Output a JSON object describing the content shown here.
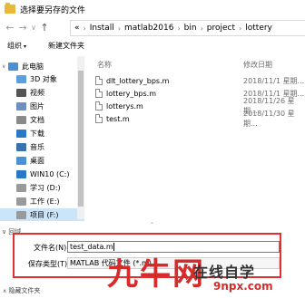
{
  "window": {
    "title": "选择要另存的文件"
  },
  "nav": {
    "back": "←",
    "forward": "→",
    "dropdown": "∨",
    "up": "↑",
    "breadcrumb_sep": "›",
    "path_overflow": "«",
    "breadcrumbs": [
      "Install",
      "matlab2016",
      "bin",
      "project",
      "lottery"
    ]
  },
  "toolbar": {
    "organize": "组织",
    "new_folder": "新建文件夹",
    "caret": "▾"
  },
  "sidebar": {
    "items": [
      {
        "label": "此电脑",
        "icon": "computer-icon",
        "color": "#4a90d9"
      },
      {
        "label": "3D 对象",
        "icon": "cube-icon",
        "color": "#5aa0e0"
      },
      {
        "label": "视频",
        "icon": "video-icon",
        "color": "#555555"
      },
      {
        "label": "图片",
        "icon": "picture-icon",
        "color": "#6a8fc0"
      },
      {
        "label": "文档",
        "icon": "document-icon",
        "color": "#8a8a8a"
      },
      {
        "label": "下载",
        "icon": "download-icon",
        "color": "#2a78c8"
      },
      {
        "label": "音乐",
        "icon": "music-icon",
        "color": "#3a6fb0"
      },
      {
        "label": "桌面",
        "icon": "desktop-icon",
        "color": "#4a90d9"
      },
      {
        "label": "WIN10 (C:)",
        "icon": "drive-icon",
        "color": "#2a78c8"
      },
      {
        "label": "学习 (D:)",
        "icon": "drive-icon",
        "color": "#9a9a9a"
      },
      {
        "label": "工作 (E:)",
        "icon": "drive-icon",
        "color": "#9a9a9a"
      },
      {
        "label": "项目 (F:)",
        "icon": "drive-icon",
        "color": "#9a9a9a"
      }
    ]
  },
  "file_list": {
    "col_name": "名称",
    "col_date": "修改日期",
    "files": [
      {
        "name": "dlt_lottery_bps.m",
        "date": "2018/11/1 星期..."
      },
      {
        "name": "lottery_bps.m",
        "date": "2018/11/1 星期..."
      },
      {
        "name": "lotterys.m",
        "date": "2018/11/26 星期..."
      },
      {
        "name": "test.m",
        "date": "2018/11/30 星期..."
      }
    ]
  },
  "save_form": {
    "filename_label": "文件名(N):",
    "filename_value": "test_data.m",
    "filetype_label": "保存类型(T):",
    "filetype_value": "MATLAB 代码文件 (*.m)",
    "hide_folders": "隐藏文件夹",
    "hide_caret": "∧",
    "collapsed_toggle": "∨ 回域"
  },
  "watermark": {
    "big": "九牛网",
    "small": "在线自学",
    "url": "9npx.com"
  }
}
